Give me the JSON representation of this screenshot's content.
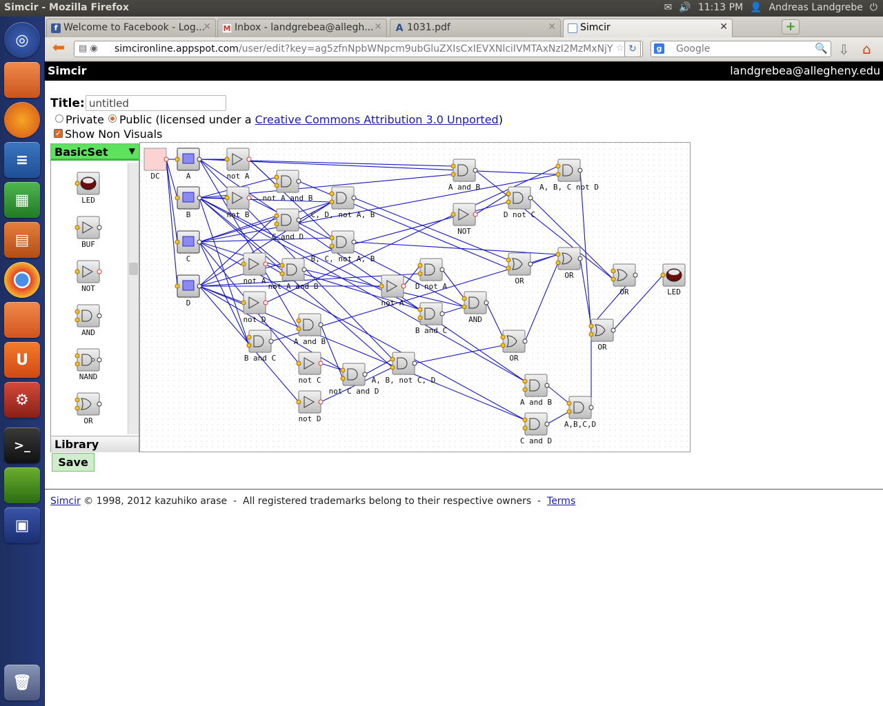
{
  "desktop": {
    "window_title": "Simcir - Mozilla Firefox",
    "clock": "11:13 PM",
    "user_name": "Andreas Landgrebe"
  },
  "tabs": [
    {
      "label": "Welcome to Facebook - Log...",
      "favicon": "f",
      "color": "#3b5998"
    },
    {
      "label": "Inbox - landgrebea@allegh...",
      "favicon": "M",
      "color": "#d93025"
    },
    {
      "label": "1031.pdf",
      "favicon": "A",
      "color": "#2c4f8c"
    },
    {
      "label": "Simcir",
      "favicon": "",
      "color": "#6a8fd6"
    }
  ],
  "navbar": {
    "url_host": "simcironline.appspot.com",
    "url_path": "/user/edit?key=ag5zfnNpbWNpcm9ubGluZXIsCxIEVXNlciIVMTAxNzI2MzMxNjY",
    "search_placeholder": "Google"
  },
  "page": {
    "app_name": "Simcir",
    "user_email": "landgrebea@allegheny.edu",
    "title_label": "Title:",
    "title_value": "untitled",
    "private_label": "Private",
    "public_label": "Public (licensed under a ",
    "license_link": "Creative Commons Attribution 3.0 Unported",
    "public_suffix": ")",
    "show_non_visuals": "Show Non Visuals",
    "save_label": "Save",
    "footer_link": "Simcir",
    "footer_text": " © 1998, 2012 kazuhiko arase  -  All registered trademarks belong to their respective owners  -  ",
    "footer_terms": "Terms"
  },
  "toolbox": {
    "header": "BasicSet",
    "library": "Library",
    "items": [
      "LED",
      "BUF",
      "NOT",
      "AND",
      "NAND",
      "OR"
    ]
  },
  "circuit": {
    "devices": [
      {
        "id": "dc",
        "type": "DC",
        "label": "DC"
      },
      {
        "id": "inA",
        "type": "IN",
        "label": "A"
      },
      {
        "id": "inB",
        "type": "IN",
        "label": "B"
      },
      {
        "id": "inC",
        "type": "IN",
        "label": "C"
      },
      {
        "id": "inD",
        "type": "IN",
        "label": "D"
      },
      {
        "id": "notA1",
        "type": "NOT",
        "label": "not A"
      },
      {
        "id": "notB1",
        "type": "NOT",
        "label": "not B"
      },
      {
        "id": "g1",
        "type": "AND",
        "label": "not A and B"
      },
      {
        "id": "g2",
        "type": "AND",
        "label": "C, D, not A, B"
      },
      {
        "id": "g3",
        "type": "AND",
        "label": "C and D"
      },
      {
        "id": "g4",
        "type": "AND",
        "label": "B, C, not A, B"
      },
      {
        "id": "notA2",
        "type": "NOT",
        "label": "not A"
      },
      {
        "id": "g5",
        "type": "AND",
        "label": "not A and B"
      },
      {
        "id": "notD1",
        "type": "NOT",
        "label": "not D"
      },
      {
        "id": "g6",
        "type": "AND",
        "label": "B and C"
      },
      {
        "id": "g7",
        "type": "AND",
        "label": "A and B"
      },
      {
        "id": "notC1",
        "type": "NOT",
        "label": "not C"
      },
      {
        "id": "notD2",
        "type": "NOT",
        "label": "not D"
      },
      {
        "id": "g8",
        "type": "AND",
        "label": "not C and D"
      },
      {
        "id": "g9",
        "type": "AND",
        "label": "A, B, not C, D"
      },
      {
        "id": "notA3",
        "type": "NOT",
        "label": "not A"
      },
      {
        "id": "g10",
        "type": "AND",
        "label": "D not A"
      },
      {
        "id": "g11",
        "type": "AND",
        "label": "B and C"
      },
      {
        "id": "g12",
        "type": "AND",
        "label": "AND"
      },
      {
        "id": "g13",
        "type": "AND",
        "label": "A and B"
      },
      {
        "id": "not5",
        "type": "NOT",
        "label": "NOT"
      },
      {
        "id": "g14",
        "type": "AND",
        "label": "D not C"
      },
      {
        "id": "or1",
        "type": "OR",
        "label": "OR"
      },
      {
        "id": "g15",
        "type": "AND",
        "label": "A, B, C not D"
      },
      {
        "id": "or2",
        "type": "OR",
        "label": "OR"
      },
      {
        "id": "or3",
        "type": "OR",
        "label": "OR"
      },
      {
        "id": "or4",
        "type": "OR",
        "label": "OR"
      },
      {
        "id": "or5",
        "type": "OR",
        "label": "OR"
      },
      {
        "id": "led",
        "type": "LED",
        "label": "LED"
      },
      {
        "id": "g16",
        "type": "AND",
        "label": "A and B"
      },
      {
        "id": "g17",
        "type": "AND",
        "label": "C and D"
      },
      {
        "id": "g18",
        "type": "AND",
        "label": "A,B,C,D"
      }
    ],
    "wires": [
      [
        "dc",
        "inA"
      ],
      [
        "dc",
        "inB"
      ],
      [
        "dc",
        "inC"
      ],
      [
        "dc",
        "inD"
      ],
      [
        "inA",
        "notA1"
      ],
      [
        "inA",
        "g13"
      ],
      [
        "inA",
        "g15"
      ],
      [
        "inA",
        "g16"
      ],
      [
        "inA",
        "g7"
      ],
      [
        "inA",
        "g9"
      ],
      [
        "inB",
        "notB1"
      ],
      [
        "inB",
        "g1"
      ],
      [
        "inB",
        "g2"
      ],
      [
        "inB",
        "g5"
      ],
      [
        "inB",
        "g6"
      ],
      [
        "inB",
        "g11"
      ],
      [
        "inB",
        "g13"
      ],
      [
        "inB",
        "g16"
      ],
      [
        "inB",
        "g9"
      ],
      [
        "inC",
        "g3"
      ],
      [
        "inC",
        "g2"
      ],
      [
        "inC",
        "g4"
      ],
      [
        "inC",
        "g6"
      ],
      [
        "inC",
        "g11"
      ],
      [
        "inC",
        "notC1"
      ],
      [
        "inC",
        "g17"
      ],
      [
        "inC",
        "g15"
      ],
      [
        "inD",
        "g3"
      ],
      [
        "inD",
        "g2"
      ],
      [
        "inD",
        "notD1"
      ],
      [
        "inD",
        "notD2"
      ],
      [
        "inD",
        "g8"
      ],
      [
        "inD",
        "g10"
      ],
      [
        "inD",
        "g17"
      ],
      [
        "inD",
        "g14"
      ],
      [
        "inD",
        "notA3"
      ],
      [
        "notA1",
        "g1"
      ],
      [
        "notA1",
        "g4"
      ],
      [
        "notA2",
        "g5"
      ],
      [
        "notA3",
        "g10"
      ],
      [
        "notB1",
        "g12"
      ],
      [
        "notD1",
        "g15"
      ],
      [
        "notD2",
        "g9"
      ],
      [
        "notC1",
        "g8"
      ],
      [
        "g1",
        "or1"
      ],
      [
        "g2",
        "or1"
      ],
      [
        "g3",
        "g2"
      ],
      [
        "g4",
        "or2"
      ],
      [
        "g5",
        "g12"
      ],
      [
        "g6",
        "or2"
      ],
      [
        "g7",
        "g8"
      ],
      [
        "g8",
        "g9"
      ],
      [
        "g9",
        "or3"
      ],
      [
        "g10",
        "g12"
      ],
      [
        "g11",
        "g12"
      ],
      [
        "g12",
        "or3"
      ],
      [
        "g13",
        "or4"
      ],
      [
        "not5",
        "g14"
      ],
      [
        "g14",
        "or4"
      ],
      [
        "or1",
        "or2"
      ],
      [
        "g15",
        "or5"
      ],
      [
        "or2",
        "or5"
      ],
      [
        "or3",
        "or2"
      ],
      [
        "or4",
        "or5"
      ],
      [
        "or5",
        "led"
      ],
      [
        "g16",
        "g18"
      ],
      [
        "g17",
        "g18"
      ],
      [
        "g18",
        "or5"
      ]
    ]
  }
}
